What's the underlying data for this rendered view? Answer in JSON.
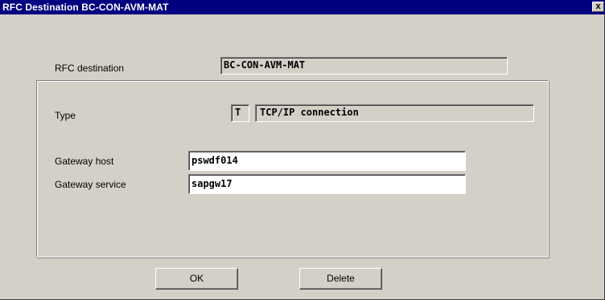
{
  "window": {
    "title": "RFC Destination BC-CON-AVM-MAT",
    "close_glyph": "x"
  },
  "rfc_destination": {
    "label": "RFC destination",
    "value": "BC-CON-AVM-MAT"
  },
  "type": {
    "label": "Type",
    "code": "T",
    "description": "TCP/IP connection"
  },
  "gateway_host": {
    "label": "Gateway host",
    "value": "pswdf014"
  },
  "gateway_service": {
    "label": "Gateway service",
    "value": "sapgw17"
  },
  "buttons": {
    "ok": "OK",
    "delete": "Delete"
  }
}
